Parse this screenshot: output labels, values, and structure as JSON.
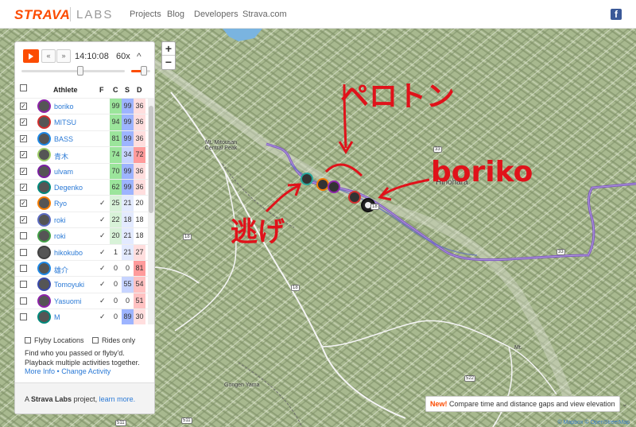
{
  "brand": {
    "name": "STRAVA",
    "sub": "LABS",
    "color": "#fc4c02"
  },
  "nav": [
    "Projects",
    "Blog",
    "Developers",
    "Strava.com"
  ],
  "social": {
    "icon": "facebook-icon",
    "glyph": "f"
  },
  "map": {
    "zoom_in": "+",
    "zoom_out": "−",
    "places": {
      "peak": "Mt. Mitousan Central Peak",
      "town": "Hinohara",
      "gongen": "Gongen Yama",
      "mt": "Mt."
    },
    "roads": [
      "18",
      "18",
      "18",
      "33",
      "33",
      "522",
      "522",
      "511",
      "511"
    ],
    "annotations": {
      "pelotonn": "ペロトン",
      "boriko": "boriko",
      "nige": "逃げ"
    },
    "new_label": "New!",
    "new_text": "Compare time and distance gaps and view elevation",
    "attribution": "© Mapbox © OpenStreetMap"
  },
  "panel": {
    "time": "14:10:08",
    "speed": "60x",
    "prev_glyph": "«",
    "next_glyph": "»",
    "collapse_glyph": "^",
    "headers": {
      "athlete": "Athlete",
      "f": "F",
      "c": "C",
      "s": "S",
      "d": "D"
    },
    "athletes": [
      {
        "checked": true,
        "name": "boriko",
        "f": "",
        "c": "99",
        "s": "99",
        "d": "36",
        "color": "#8e24aa"
      },
      {
        "checked": true,
        "name": "MITSU",
        "f": "",
        "c": "94",
        "s": "99",
        "d": "36",
        "color": "#d32f2f"
      },
      {
        "checked": true,
        "name": "BASS",
        "f": "",
        "c": "81",
        "s": "99",
        "d": "36",
        "color": "#1e88e5"
      },
      {
        "checked": true,
        "name": "青木",
        "f": "",
        "c": "74",
        "s": "34",
        "d": "72",
        "color": "#9ccc65"
      },
      {
        "checked": true,
        "name": "ulvam",
        "f": "",
        "c": "70",
        "s": "99",
        "d": "36",
        "color": "#7b1fa2"
      },
      {
        "checked": true,
        "name": "Degenko",
        "f": "",
        "c": "62",
        "s": "99",
        "d": "36",
        "color": "#00897b"
      },
      {
        "checked": true,
        "name": "Ryo",
        "f": "✓",
        "c": "25",
        "s": "21",
        "d": "20",
        "color": "#f57c00"
      },
      {
        "checked": true,
        "name": "roki",
        "f": "✓",
        "c": "22",
        "s": "18",
        "d": "18",
        "color": "#5c6bc0"
      },
      {
        "checked": false,
        "name": "roki",
        "f": "✓",
        "c": "20",
        "s": "21",
        "d": "18",
        "color": "#43a047"
      },
      {
        "checked": false,
        "name": "hikokubo",
        "f": "✓",
        "c": "1",
        "s": "21",
        "d": "27",
        "color": "#424242"
      },
      {
        "checked": false,
        "name": "雄介",
        "f": "✓",
        "c": "0",
        "s": "0",
        "d": "81",
        "color": "#1e88e5"
      },
      {
        "checked": false,
        "name": "Tomoyuki",
        "f": "✓",
        "c": "0",
        "s": "55",
        "d": "54",
        "color": "#3949ab"
      },
      {
        "checked": false,
        "name": "Yasuomi",
        "f": "✓",
        "c": "0",
        "s": "0",
        "d": "51",
        "color": "#8e24aa"
      },
      {
        "checked": false,
        "name": "M",
        "f": "✓",
        "c": "0",
        "s": "89",
        "d": "30",
        "color": "#00897b"
      }
    ],
    "flyby_label": "Flyby Locations",
    "rides_label": "Rides only",
    "description": "Find who you passed or flyby'd. Playback multiple activities together.",
    "more_info": "More Info",
    "change_activity": "Change Activity",
    "footer_prefix": "A",
    "footer_brand": "Strava Labs",
    "footer_mid": "project,",
    "footer_link": "learn more."
  }
}
